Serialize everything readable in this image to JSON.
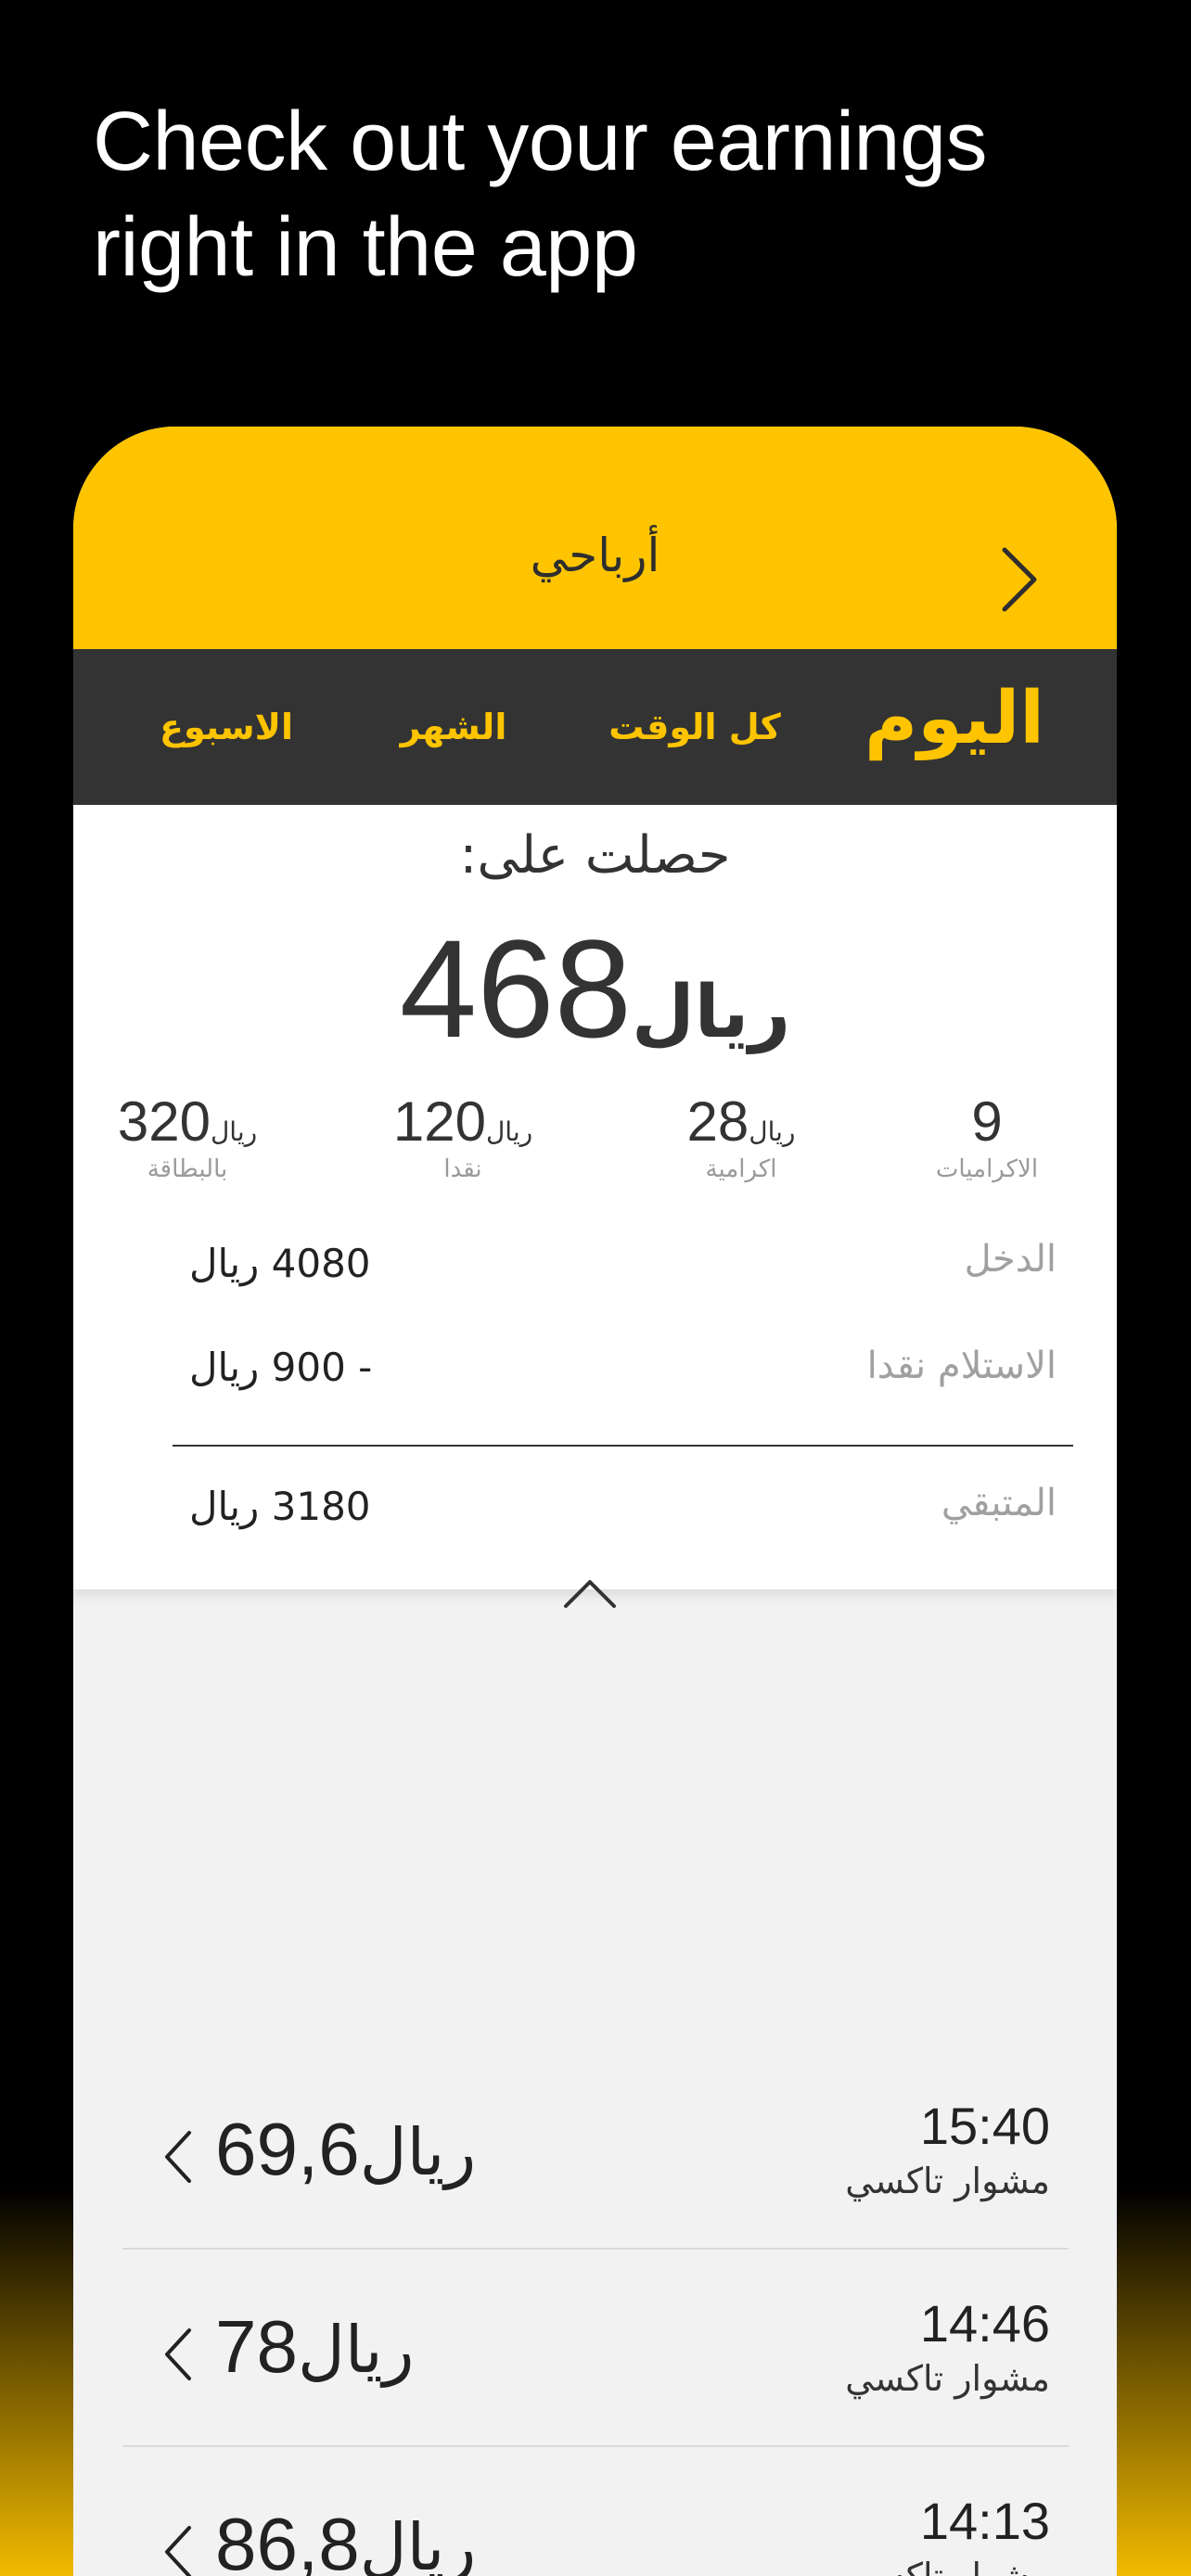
{
  "headline": {
    "line1": "Check out your earnings",
    "line2": "right in the app"
  },
  "header": {
    "title": "أرباحي"
  },
  "tabs": {
    "today": "اليوم",
    "all_time": "كل الوقت",
    "month": "الشهر",
    "week": "الاسبوع"
  },
  "summary": {
    "earned_label": "حصلت على:",
    "total_value": "468",
    "total_currency": "ريال",
    "stats": {
      "bonuses": {
        "value": "9",
        "currency": "",
        "label": "الاكراميات"
      },
      "tip": {
        "value": "28",
        "currency": "ريال",
        "label": "اكرامية"
      },
      "cash": {
        "value": "120",
        "currency": "ريال",
        "label": "نقدا"
      },
      "card": {
        "value": "320",
        "currency": "ريال",
        "label": "بالبطاقة"
      }
    },
    "rows": {
      "income_label": "الدخل",
      "income_value": "4080 ريال",
      "cash_received_label": "الاستلام نقدا",
      "cash_received_value": "- 900 ريال",
      "remaining_label": "المتبقي",
      "remaining_value": "3180 ريال"
    }
  },
  "trips": [
    {
      "time": "15:40",
      "type": "مشوار تاكسي",
      "amount": "69,6",
      "currency": "ريال"
    },
    {
      "time": "14:46",
      "type": "مشوار تاكسي",
      "amount": "78",
      "currency": "ريال"
    },
    {
      "time": "14:13",
      "type": "مشوار تاكسي",
      "amount": "86,8",
      "currency": "ريال"
    }
  ],
  "colors": {
    "brand_yellow": "#fec400",
    "tab_bar": "#333333",
    "background": "#000000"
  },
  "icons": {
    "back": "chevron-right-icon",
    "collapse": "chevron-up-icon",
    "trip_detail": "chevron-left-icon"
  }
}
